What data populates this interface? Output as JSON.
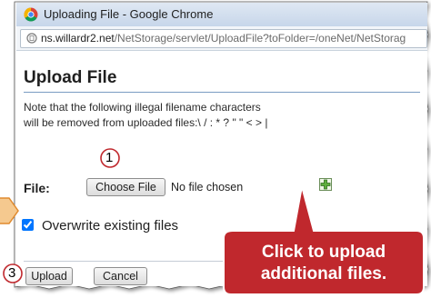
{
  "window": {
    "title": "Uploading File - Google Chrome",
    "url_host": "ns.willardr2.net",
    "url_path": "/NetStorage/servlet/UploadFile?toFolder=/oneNet/NetStorag"
  },
  "page": {
    "title": "Upload File",
    "note_line1": "Note that the following illegal filename characters",
    "note_line2": "will be removed from uploaded files:\\ / : * ? \" \" < > |"
  },
  "file": {
    "label": "File:",
    "choose_button": "Choose File",
    "status": "No file chosen"
  },
  "overwrite": {
    "label": "Overwrite existing files",
    "checked": true
  },
  "buttons": {
    "upload": "Upload",
    "cancel": "Cancel"
  },
  "annotations": {
    "step1": "1",
    "step3": "3",
    "callout_line1": "Click to upload",
    "callout_line2": "additional files.",
    "callout_color": "#c0282d",
    "circle_color": "#c0282d",
    "arrow_color": "#e8a24a"
  },
  "icons": {
    "browser": "chrome-logo-icon",
    "page": "page-icon",
    "add_file": "plus-icon"
  }
}
